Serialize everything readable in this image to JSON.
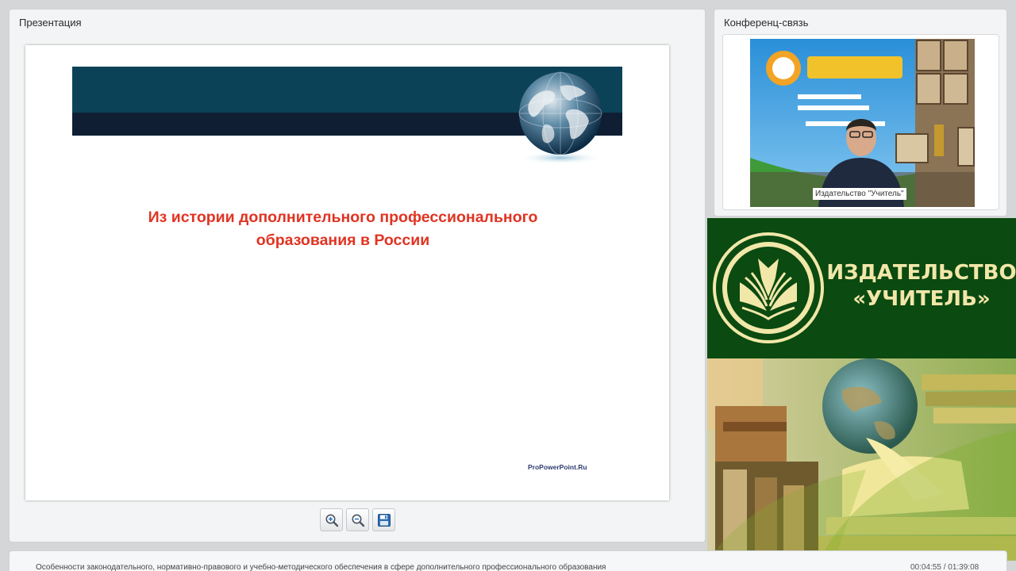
{
  "presentation_panel": {
    "title": "Презентация",
    "slide": {
      "title": "Из истории дополнительного профессионального\nобразования в России",
      "credit": "ProPowerPoint.Ru"
    },
    "toolbar": {
      "zoom_in_icon": "zoom-in-icon",
      "zoom_out_icon": "zoom-out-icon",
      "save_icon": "floppy-disk-icon"
    }
  },
  "conference_panel": {
    "title": "Конференц-связь",
    "video_label": "Издательство \"Учитель\""
  },
  "brand_banner": {
    "name": "ИЗДАТЕЛЬСТВО\n«УЧИТЕЛЬ»",
    "colors": {
      "background": "#0b4a10",
      "text": "#f1e7a9"
    }
  },
  "footer": {
    "title": "Особенности законодательного, нормативно-правового и учебно-методического обеспечения в сфере дополнительного профессионального образования",
    "time": "00:04:55 / 01:39:08"
  }
}
